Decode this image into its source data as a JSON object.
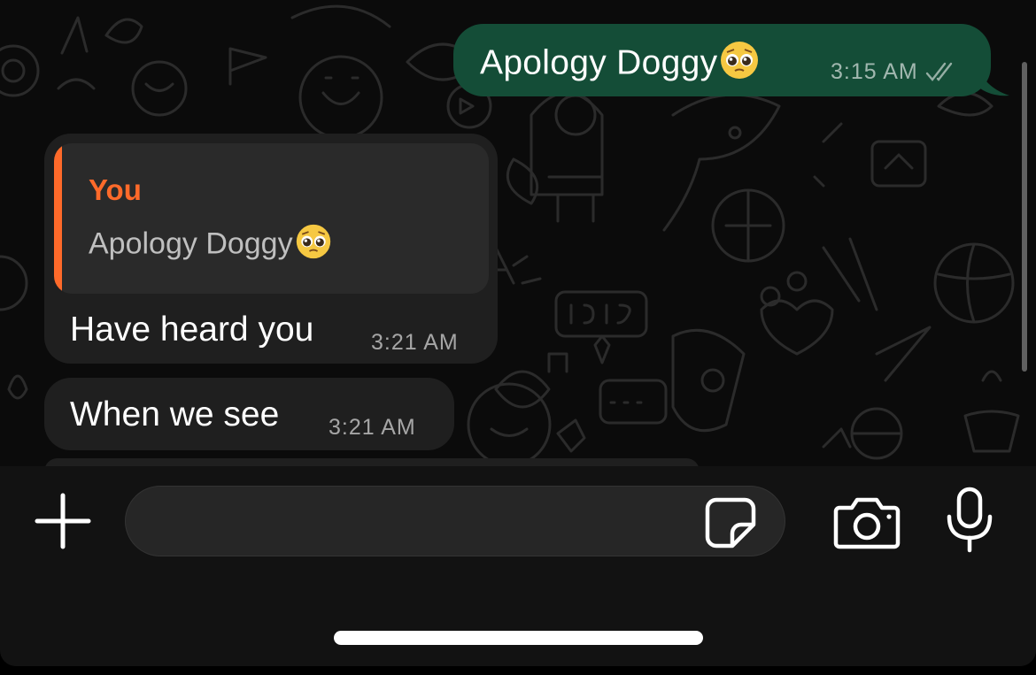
{
  "messages": [
    {
      "direction": "outgoing",
      "text": "Apology Doggy",
      "emoji": "pleading-face",
      "time": "3:15 AM",
      "status": "delivered-double-check"
    },
    {
      "direction": "incoming",
      "reply_to": {
        "author": "You",
        "text": "Apology Doggy",
        "emoji": "pleading-face"
      },
      "text": "Have heard you",
      "time": "3:21 AM"
    },
    {
      "direction": "incoming",
      "text": "When we see",
      "time": "3:21 AM"
    }
  ],
  "composer": {
    "input_value": "",
    "placeholder": ""
  },
  "icons": {
    "attach": "plus-icon",
    "sticker": "sticker-icon",
    "camera": "camera-icon",
    "voice": "microphone-icon",
    "read_receipt": "double-check-icon"
  },
  "colors": {
    "outgoing_bubble": "#144d37",
    "incoming_bubble": "#1f1f1f",
    "quote_accent": "#ff6a2a",
    "background": "#0b0b0b"
  }
}
